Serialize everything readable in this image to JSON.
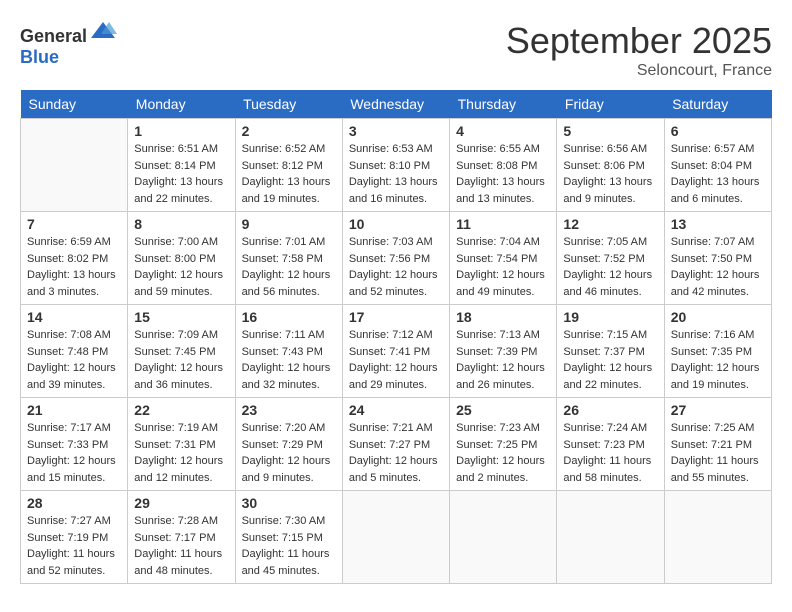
{
  "header": {
    "logo_general": "General",
    "logo_blue": "Blue",
    "month_title": "September 2025",
    "location": "Seloncourt, France"
  },
  "days_of_week": [
    "Sunday",
    "Monday",
    "Tuesday",
    "Wednesday",
    "Thursday",
    "Friday",
    "Saturday"
  ],
  "weeks": [
    [
      {
        "day": "",
        "info": ""
      },
      {
        "day": "1",
        "info": "Sunrise: 6:51 AM\nSunset: 8:14 PM\nDaylight: 13 hours\nand 22 minutes."
      },
      {
        "day": "2",
        "info": "Sunrise: 6:52 AM\nSunset: 8:12 PM\nDaylight: 13 hours\nand 19 minutes."
      },
      {
        "day": "3",
        "info": "Sunrise: 6:53 AM\nSunset: 8:10 PM\nDaylight: 13 hours\nand 16 minutes."
      },
      {
        "day": "4",
        "info": "Sunrise: 6:55 AM\nSunset: 8:08 PM\nDaylight: 13 hours\nand 13 minutes."
      },
      {
        "day": "5",
        "info": "Sunrise: 6:56 AM\nSunset: 8:06 PM\nDaylight: 13 hours\nand 9 minutes."
      },
      {
        "day": "6",
        "info": "Sunrise: 6:57 AM\nSunset: 8:04 PM\nDaylight: 13 hours\nand 6 minutes."
      }
    ],
    [
      {
        "day": "7",
        "info": "Sunrise: 6:59 AM\nSunset: 8:02 PM\nDaylight: 13 hours\nand 3 minutes."
      },
      {
        "day": "8",
        "info": "Sunrise: 7:00 AM\nSunset: 8:00 PM\nDaylight: 12 hours\nand 59 minutes."
      },
      {
        "day": "9",
        "info": "Sunrise: 7:01 AM\nSunset: 7:58 PM\nDaylight: 12 hours\nand 56 minutes."
      },
      {
        "day": "10",
        "info": "Sunrise: 7:03 AM\nSunset: 7:56 PM\nDaylight: 12 hours\nand 52 minutes."
      },
      {
        "day": "11",
        "info": "Sunrise: 7:04 AM\nSunset: 7:54 PM\nDaylight: 12 hours\nand 49 minutes."
      },
      {
        "day": "12",
        "info": "Sunrise: 7:05 AM\nSunset: 7:52 PM\nDaylight: 12 hours\nand 46 minutes."
      },
      {
        "day": "13",
        "info": "Sunrise: 7:07 AM\nSunset: 7:50 PM\nDaylight: 12 hours\nand 42 minutes."
      }
    ],
    [
      {
        "day": "14",
        "info": "Sunrise: 7:08 AM\nSunset: 7:48 PM\nDaylight: 12 hours\nand 39 minutes."
      },
      {
        "day": "15",
        "info": "Sunrise: 7:09 AM\nSunset: 7:45 PM\nDaylight: 12 hours\nand 36 minutes."
      },
      {
        "day": "16",
        "info": "Sunrise: 7:11 AM\nSunset: 7:43 PM\nDaylight: 12 hours\nand 32 minutes."
      },
      {
        "day": "17",
        "info": "Sunrise: 7:12 AM\nSunset: 7:41 PM\nDaylight: 12 hours\nand 29 minutes."
      },
      {
        "day": "18",
        "info": "Sunrise: 7:13 AM\nSunset: 7:39 PM\nDaylight: 12 hours\nand 26 minutes."
      },
      {
        "day": "19",
        "info": "Sunrise: 7:15 AM\nSunset: 7:37 PM\nDaylight: 12 hours\nand 22 minutes."
      },
      {
        "day": "20",
        "info": "Sunrise: 7:16 AM\nSunset: 7:35 PM\nDaylight: 12 hours\nand 19 minutes."
      }
    ],
    [
      {
        "day": "21",
        "info": "Sunrise: 7:17 AM\nSunset: 7:33 PM\nDaylight: 12 hours\nand 15 minutes."
      },
      {
        "day": "22",
        "info": "Sunrise: 7:19 AM\nSunset: 7:31 PM\nDaylight: 12 hours\nand 12 minutes."
      },
      {
        "day": "23",
        "info": "Sunrise: 7:20 AM\nSunset: 7:29 PM\nDaylight: 12 hours\nand 9 minutes."
      },
      {
        "day": "24",
        "info": "Sunrise: 7:21 AM\nSunset: 7:27 PM\nDaylight: 12 hours\nand 5 minutes."
      },
      {
        "day": "25",
        "info": "Sunrise: 7:23 AM\nSunset: 7:25 PM\nDaylight: 12 hours\nand 2 minutes."
      },
      {
        "day": "26",
        "info": "Sunrise: 7:24 AM\nSunset: 7:23 PM\nDaylight: 11 hours\nand 58 minutes."
      },
      {
        "day": "27",
        "info": "Sunrise: 7:25 AM\nSunset: 7:21 PM\nDaylight: 11 hours\nand 55 minutes."
      }
    ],
    [
      {
        "day": "28",
        "info": "Sunrise: 7:27 AM\nSunset: 7:19 PM\nDaylight: 11 hours\nand 52 minutes."
      },
      {
        "day": "29",
        "info": "Sunrise: 7:28 AM\nSunset: 7:17 PM\nDaylight: 11 hours\nand 48 minutes."
      },
      {
        "day": "30",
        "info": "Sunrise: 7:30 AM\nSunset: 7:15 PM\nDaylight: 11 hours\nand 45 minutes."
      },
      {
        "day": "",
        "info": ""
      },
      {
        "day": "",
        "info": ""
      },
      {
        "day": "",
        "info": ""
      },
      {
        "day": "",
        "info": ""
      }
    ]
  ]
}
